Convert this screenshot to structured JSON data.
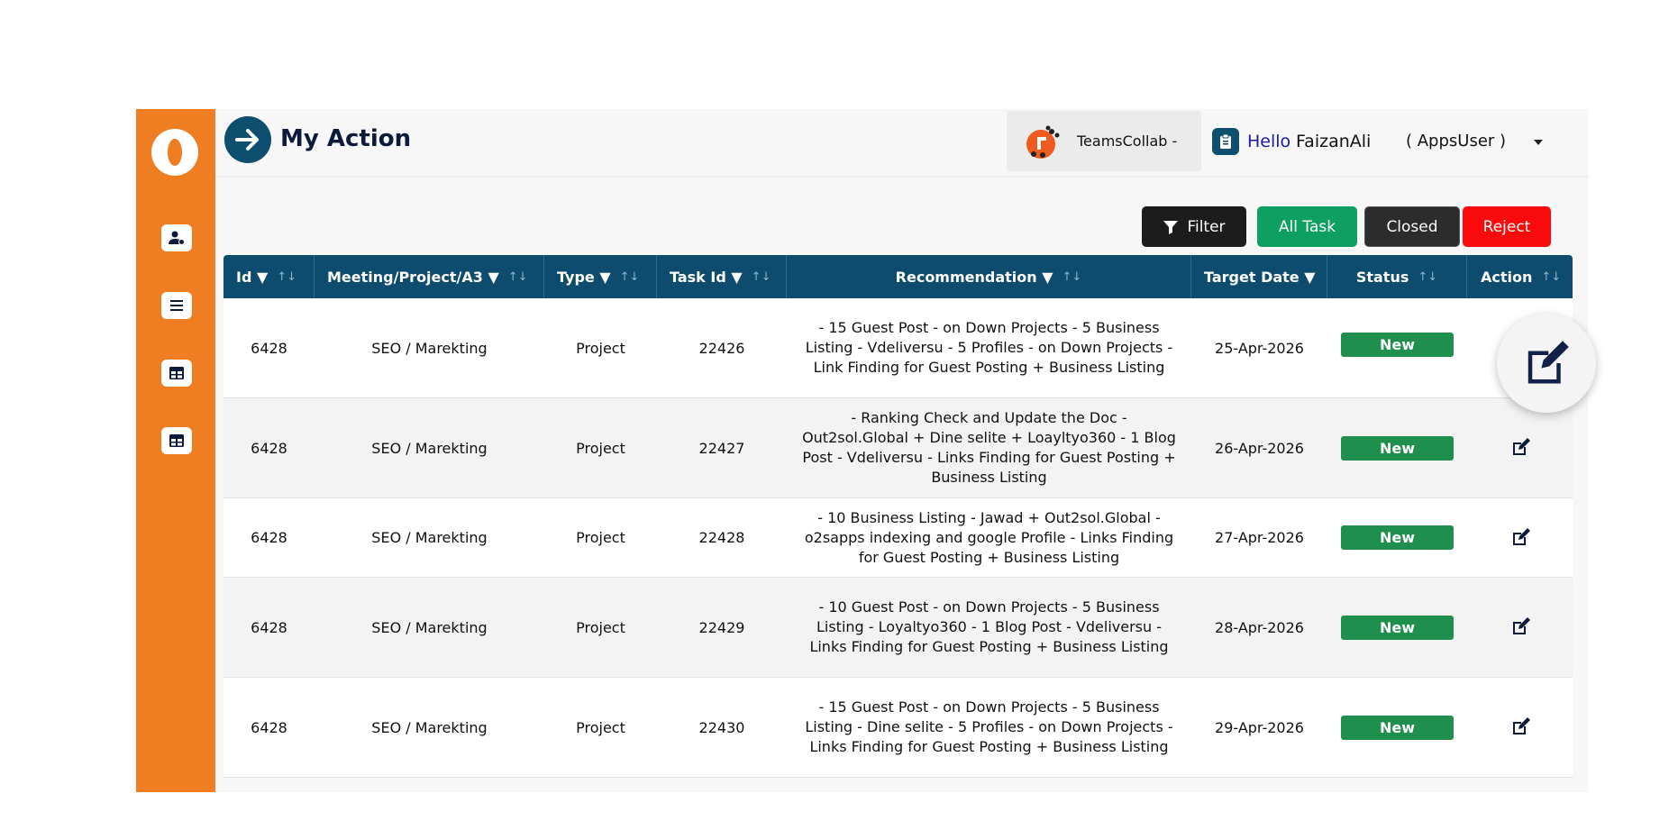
{
  "header": {
    "title": "My Action",
    "team_name": "TeamsCollab -",
    "hello_word": "Hello",
    "user_name": "FaizanAli",
    "user_role": "( AppsUser )"
  },
  "sidebar": {
    "icons": [
      "user-settings-icon",
      "list-icon",
      "table-icon",
      "grid-table-icon"
    ]
  },
  "toolbar": {
    "filter_label": "Filter",
    "all_label": "All Task",
    "closed_label": "Closed",
    "reject_label": "Reject"
  },
  "colors": {
    "sidebar": "#ef7d22",
    "header_table": "#0d4c6e",
    "status_new": "#1f8f4e",
    "all_task": "#0da062",
    "reject": "#fa0b0b"
  },
  "table": {
    "columns": [
      {
        "label": "Id ▼",
        "sort": "↑↓"
      },
      {
        "label": "Meeting/Project/A3 ▼",
        "sort": "↑↓"
      },
      {
        "label": "Type ▼",
        "sort": "↑↓"
      },
      {
        "label": "Task Id ▼",
        "sort": "↑↓"
      },
      {
        "label": "Recommendation ▼",
        "sort": "↑↓"
      },
      {
        "label": "Target Date ▼",
        "sort": ""
      },
      {
        "label": "Status",
        "sort": "↑↓"
      },
      {
        "label": "Action",
        "sort": "↑↓"
      }
    ],
    "rows": [
      {
        "id": "6428",
        "meeting": "SEO / Marekting",
        "type": "Project",
        "task_id": "22426",
        "recommendation": "- 15 Guest Post - on Down Projects - 5 Business Listing - Vdeliversu - 5 Profiles - on Down Projects - Link Finding for Guest Posting + Business Listing",
        "target_date": "25-Apr-2026",
        "status": "New"
      },
      {
        "id": "6428",
        "meeting": "SEO / Marekting",
        "type": "Project",
        "task_id": "22427",
        "recommendation": "- Ranking Check and Update the Doc - Out2sol.Global + Dine selite + Loayltyo360 - 1 Blog Post - Vdeliversu - Links Finding for Guest Posting + Business Listing",
        "target_date": "26-Apr-2026",
        "status": "New"
      },
      {
        "id": "6428",
        "meeting": "SEO / Marekting",
        "type": "Project",
        "task_id": "22428",
        "recommendation": "- 10 Business Listing - Jawad + Out2sol.Global - o2sapps indexing and google Profile - Links Finding for Guest Posting + Business Listing",
        "target_date": "27-Apr-2026",
        "status": "New"
      },
      {
        "id": "6428",
        "meeting": "SEO / Marekting",
        "type": "Project",
        "task_id": "22429",
        "recommendation": "- 10 Guest Post - on Down Projects - 5 Business Listing - Loyaltyo360 - 1 Blog Post - Vdeliversu - Links Finding for Guest Posting + Business Listing",
        "target_date": "28-Apr-2026",
        "status": "New"
      },
      {
        "id": "6428",
        "meeting": "SEO / Marekting",
        "type": "Project",
        "task_id": "22430",
        "recommendation": "- 15 Guest Post - on Down Projects - 5 Business Listing - Dine selite - 5 Profiles - on Down Projects - Links Finding for Guest Posting + Business Listing",
        "target_date": "29-Apr-2026",
        "status": "New"
      }
    ]
  }
}
